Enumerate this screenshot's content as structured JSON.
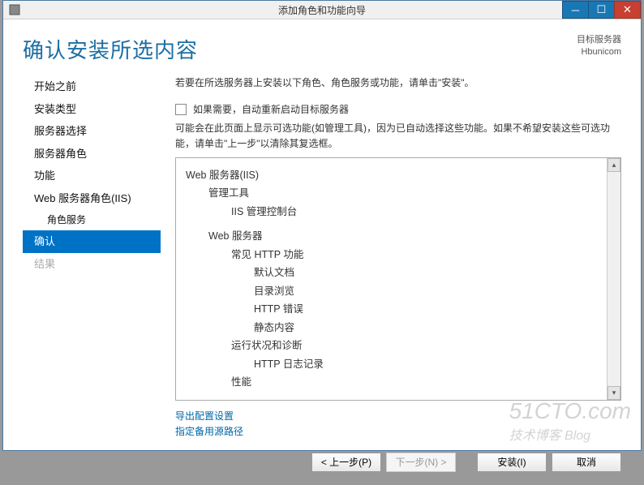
{
  "titlebar": {
    "title": "添加角色和功能向导"
  },
  "header": {
    "title": "确认安装所选内容",
    "server_label": "目标服务器",
    "server_name": "Hbunicom"
  },
  "sidebar": {
    "items": [
      {
        "label": "开始之前",
        "state": "normal"
      },
      {
        "label": "安装类型",
        "state": "normal"
      },
      {
        "label": "服务器选择",
        "state": "normal"
      },
      {
        "label": "服务器角色",
        "state": "normal"
      },
      {
        "label": "功能",
        "state": "normal"
      },
      {
        "label": "Web 服务器角色(IIS)",
        "state": "normal"
      },
      {
        "label": "角色服务",
        "state": "sub"
      },
      {
        "label": "确认",
        "state": "selected"
      },
      {
        "label": "结果",
        "state": "disabled"
      }
    ]
  },
  "main": {
    "desc": "若要在所选服务器上安装以下角色、角色服务或功能，请单击\"安装\"。",
    "checkbox_label": "如果需要，自动重新启动目标服务器",
    "note": "可能会在此页面上显示可选功能(如管理工具)，因为已自动选择这些功能。如果不希望安装这些可选功能，请单击\"上一步\"以清除其复选框。",
    "tree": [
      {
        "label": "Web 服务器(IIS)",
        "level": 1
      },
      {
        "label": "管理工具",
        "level": 2
      },
      {
        "label": "IIS 管理控制台",
        "level": 3
      },
      {
        "label": "Web 服务器",
        "level": 2
      },
      {
        "label": "常见 HTTP 功能",
        "level": 3
      },
      {
        "label": "默认文档",
        "level": 4
      },
      {
        "label": "目录浏览",
        "level": 4
      },
      {
        "label": "HTTP 错误",
        "level": 4
      },
      {
        "label": "静态内容",
        "level": 4
      },
      {
        "label": "运行状况和诊断",
        "level": 3
      },
      {
        "label": "HTTP 日志记录",
        "level": 4
      },
      {
        "label": "性能",
        "level": 3
      }
    ],
    "links": {
      "export": "导出配置设置",
      "alt_path": "指定备用源路径"
    }
  },
  "buttons": {
    "prev": "< 上一步(P)",
    "next": "下一步(N) >",
    "install": "安装(I)",
    "cancel": "取消"
  },
  "watermark": {
    "line1": "51CTO.com",
    "line2": "技术博客 Blog"
  }
}
